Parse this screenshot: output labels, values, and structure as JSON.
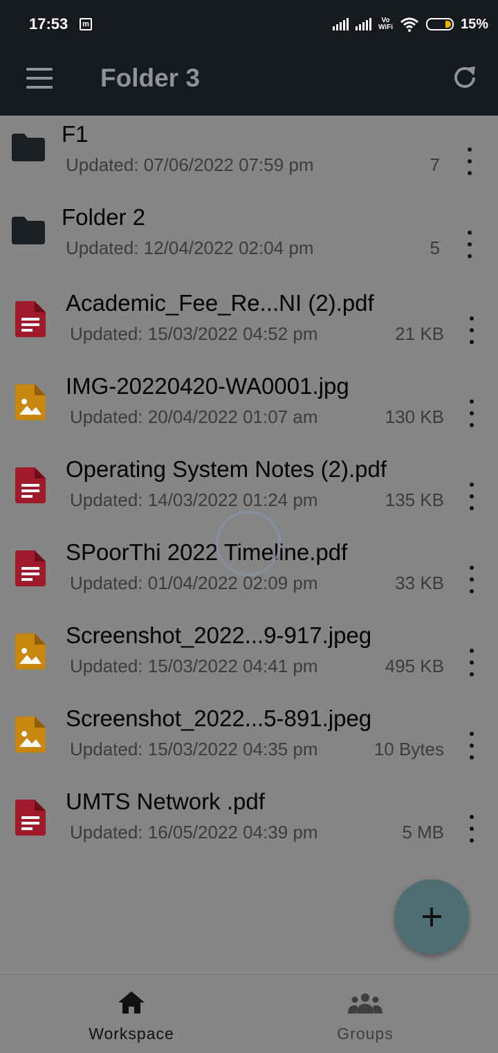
{
  "status_bar": {
    "time": "17:53",
    "notif_badge": "m",
    "vowifi": [
      "Vo",
      "WiFi"
    ],
    "battery": "15%"
  },
  "app_bar": {
    "title": "Folder 3",
    "menu_icon": "menu-icon",
    "refresh_icon": "refresh-icon"
  },
  "items": [
    {
      "type": "folder",
      "name": "F1",
      "updated": "Updated: 07/06/2022 07:59 pm",
      "size": "7"
    },
    {
      "type": "folder",
      "name": "Folder 2",
      "updated": "Updated: 12/04/2022 02:04 pm",
      "size": "5"
    },
    {
      "type": "pdf",
      "name": "Academic_Fee_Re...NI (2).pdf",
      "updated": "Updated: 15/03/2022 04:52 pm",
      "size": "21 KB"
    },
    {
      "type": "image",
      "name": "IMG-20220420-WA0001.jpg",
      "updated": "Updated: 20/04/2022 01:07 am",
      "size": "130 KB"
    },
    {
      "type": "pdf",
      "name": "Operating System Notes (2).pdf",
      "updated": "Updated: 14/03/2022 01:24 pm",
      "size": "135 KB"
    },
    {
      "type": "pdf",
      "name": "SPoorThi 2022 Timeline.pdf",
      "updated": "Updated: 01/04/2022 02:09 pm",
      "size": "33 KB"
    },
    {
      "type": "image",
      "name": "Screenshot_2022...9-917.jpeg",
      "updated": "Updated: 15/03/2022 04:41 pm",
      "size": "495 KB"
    },
    {
      "type": "image",
      "name": "Screenshot_2022...5-891.jpeg",
      "updated": "Updated: 15/03/2022 04:35 pm",
      "size": "10 Bytes"
    },
    {
      "type": "pdf",
      "name": "UMTS Network .pdf",
      "updated": "Updated: 16/05/2022 04:39 pm",
      "size": "5 MB"
    }
  ],
  "fab": {
    "icon": "plus-icon"
  },
  "bottom_nav": [
    {
      "label": "Workspace",
      "icon": "home-icon",
      "active": true
    },
    {
      "label": "Groups",
      "icon": "groups-icon",
      "active": false
    }
  ],
  "colors": {
    "pdf": "#a11a2c",
    "image": "#c8860f",
    "folder": "#1b1e23",
    "bar": "#16191e",
    "fab": "#4d6f71"
  }
}
